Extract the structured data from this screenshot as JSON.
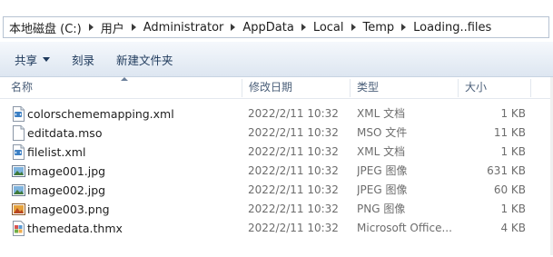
{
  "breadcrumb": [
    "本地磁盘 (C:)",
    "用户",
    "Administrator",
    "AppData",
    "Local",
    "Temp",
    "Loading..files"
  ],
  "toolbar": {
    "share_label": "共享",
    "burn_label": "刻录",
    "new_folder_label": "新建文件夹"
  },
  "columns": {
    "name": "名称",
    "date": "修改日期",
    "type": "类型",
    "size": "大小"
  },
  "files": [
    {
      "name": "colorschememapping.xml",
      "date": "2022/2/11 10:32",
      "type": "XML 文档",
      "size": "1 KB",
      "icon": "xml-file-icon"
    },
    {
      "name": "editdata.mso",
      "date": "2022/2/11 10:32",
      "type": "MSO 文件",
      "size": "11 KB",
      "icon": "blank-file-icon"
    },
    {
      "name": "filelist.xml",
      "date": "2022/2/11 10:32",
      "type": "XML 文档",
      "size": "1 KB",
      "icon": "xml-file-icon"
    },
    {
      "name": "image001.jpg",
      "date": "2022/2/11 10:32",
      "type": "JPEG 图像",
      "size": "631 KB",
      "icon": "jpeg-image-icon"
    },
    {
      "name": "image002.jpg",
      "date": "2022/2/11 10:32",
      "type": "JPEG 图像",
      "size": "60 KB",
      "icon": "jpeg-image-icon"
    },
    {
      "name": "image003.png",
      "date": "2022/2/11 10:32",
      "type": "PNG 图像",
      "size": "1 KB",
      "icon": "png-image-icon"
    },
    {
      "name": "themedata.thmx",
      "date": "2022/2/11 10:32",
      "type": "Microsoft Office...",
      "size": "4 KB",
      "icon": "office-theme-icon"
    }
  ],
  "colors": {
    "toolbar_text": "#1e395b",
    "header_text": "#4c607a",
    "detail_text": "#6d6d6d"
  }
}
